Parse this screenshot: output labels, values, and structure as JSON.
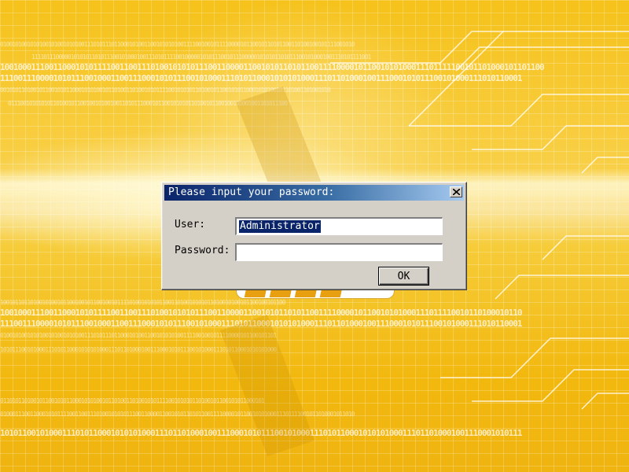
{
  "background": {
    "binary_rows": [
      "0100101001010100101001010100111010111011000101001100101010100111100100101111000010110010110101100110100100101111001010",
      "11110111000001010101101011100101000100111010111100100000101011100101110000010101011010111001010001001110101111001",
      "100100011100110001010111100110011101001010101110011000011001010110101100111100001011001010100011101111100101101000101101100",
      "1110011100001010111001000110011100010101110010100011101011000101010100011101101000100111000101011100101000111010110001",
      "00101011010010110010101100010101001011010011010010101111001010101101001011001010110001010100101101001101001010",
      "011100101010101101001011001001010010011010111000101100101010110100101100100101001001101011100",
      "10010110110100101001011001001011001001011110100101010110011010010101011010010100101100100101100",
      "1001000111001100010101111001100111010010101011100110000110010101101011001111000010110010101000111011110010110100010110",
      "1110011100001010111001000110011100010101110010100011101011000101010100011101101000100111000101011100101000111010110001",
      "01001010010101001010010101001110101110110001010011001010101001111001001011110000101100101101",
      "10101110010100011101011000101010100011101101000100111000101011100101000111010110001010101000",
      "0110101101001011001010110001010100101101001101001010111100101010110100101100101011000101",
      "0100011100110001010111100110011101001010101110011000011001010110101100111100001011001010100011101111001011010001011010",
      "1010110010100011101011000101010100011101101000100111000101011100101000111010110001010101000111011010001001110001010111"
    ]
  },
  "dialog": {
    "title": "Please input your password:",
    "close_symbol": "×",
    "user_label": "User:",
    "user_value": "Administrator",
    "password_label": "Password:",
    "password_value": "",
    "ok_label": "OK"
  },
  "colors": {
    "title_gradient_start": "#0a246a",
    "title_gradient_end": "#a6caf0",
    "dialog_face": "#d4d0c8",
    "selection": "#0a246a",
    "desktop_base": "#f2bc12"
  }
}
